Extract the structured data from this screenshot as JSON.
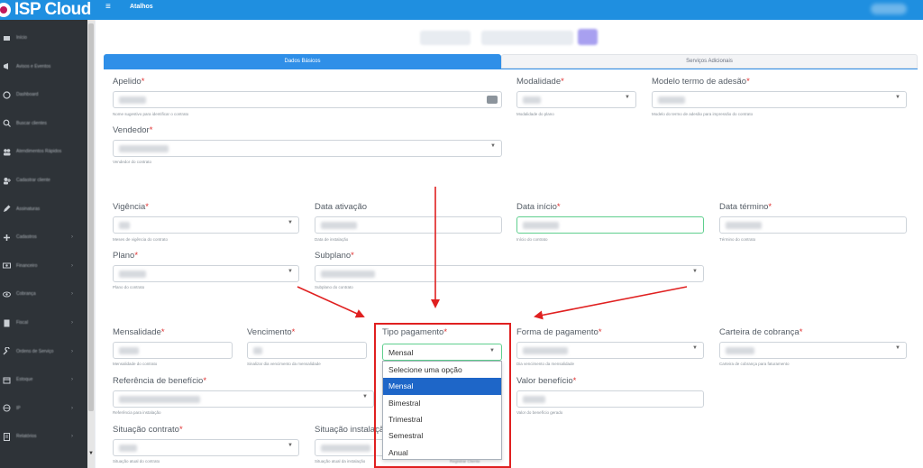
{
  "app": {
    "logo": "ISP Cloud",
    "menu_glyph": "≡",
    "top_link": "Atalhos"
  },
  "sidebar": {
    "items": [
      {
        "label": "Início",
        "icon": "dashboard-icon",
        "chevron": ""
      },
      {
        "label": "Avisos e Eventos",
        "icon": "megaphone-icon",
        "chevron": ""
      },
      {
        "label": "Dashboard",
        "icon": "gauge-icon",
        "chevron": ""
      },
      {
        "label": "Buscar clientes",
        "icon": "search-icon",
        "chevron": ""
      },
      {
        "label": "Atendimentos Rápidos",
        "icon": "users-icon",
        "chevron": ""
      },
      {
        "label": "Cadastrar cliente",
        "icon": "user-plus-icon",
        "chevron": ""
      },
      {
        "label": "Assinaturas",
        "icon": "pencil-icon",
        "chevron": ""
      },
      {
        "label": "Cadastros",
        "icon": "plus-icon",
        "chevron": "›"
      },
      {
        "label": "Financeiro",
        "icon": "money-icon",
        "chevron": "›"
      },
      {
        "label": "Cobrança",
        "icon": "eye-icon",
        "chevron": "›"
      },
      {
        "label": "Fiscal",
        "icon": "file-icon",
        "chevron": "›"
      },
      {
        "label": "Ordens de Serviço",
        "icon": "wrench-icon",
        "chevron": "›"
      },
      {
        "label": "Estoque",
        "icon": "box-icon",
        "chevron": "›"
      },
      {
        "label": "IP",
        "icon": "globe-icon",
        "chevron": "›"
      },
      {
        "label": "Relatórios",
        "icon": "report-icon",
        "chevron": "›"
      }
    ],
    "scroll_down": "▼"
  },
  "tabs": [
    {
      "label": "Dados Básicos"
    },
    {
      "label": "Serviços Adicionais"
    }
  ],
  "form": {
    "apelido": {
      "label": "Apelido",
      "help": "Nome sugestivo para identificar o contrato"
    },
    "modalidade": {
      "label": "Modalidade",
      "help": "Modalidade do plano"
    },
    "modelo_termo": {
      "label": "Modelo termo de adesão",
      "help": "Modelo do termo de adesão para impressão do contrato"
    },
    "vendedor": {
      "label": "Vendedor",
      "help": "Vendedor do contrato"
    },
    "vigencia": {
      "label": "Vigência",
      "help": "Meses de vigência do contrato"
    },
    "data_ativacao": {
      "label": "Data ativação",
      "help": "Data de instalação"
    },
    "data_inicio": {
      "label": "Data início",
      "help": "Início do contrato"
    },
    "data_termino": {
      "label": "Data término",
      "help": "Término do contrato"
    },
    "plano": {
      "label": "Plano",
      "help": "Plano do contrato"
    },
    "subplano": {
      "label": "Subplano",
      "help": "Subplano do contrato"
    },
    "mensalidade": {
      "label": "Mensalidade",
      "help": "Mensalidade do contrato"
    },
    "vencimento": {
      "label": "Vencimento",
      "help": "Sinalizar dia vencimento da mensalidade"
    },
    "tipo_pagamento": {
      "label": "Tipo pagamento",
      "value": "Mensal"
    },
    "forma_pagamento": {
      "label": "Forma de pagamento",
      "help": "Dia vencimento da mensalidade"
    },
    "carteira_cobranca": {
      "label": "Carteira de cobrança",
      "help": "Carteira de cobrança para faturamento"
    },
    "referencia_beneficio": {
      "label": "Referência de benefício",
      "help": "Referência para instalação"
    },
    "valor_beneficio": {
      "label": "Valor benefício",
      "help": "Valor do benefício gerado"
    },
    "situacao_contrato": {
      "label": "Situação contrato",
      "help": "Situação atual do contrato"
    },
    "situacao_instalacao": {
      "label": "Situação instalação",
      "help": "Situação atual da instalação",
      "extra": "Registrar Cliente"
    }
  },
  "dropdown": {
    "options": [
      "Selecione uma opção",
      "Mensal",
      "Bimestral",
      "Trimestral",
      "Semestral",
      "Anual"
    ],
    "selected": "Mensal"
  },
  "colors": {
    "topbar": "#1f8fe0",
    "sidebar": "#2e3338",
    "accent": "#2f8fe8",
    "annotation": "#e02020",
    "selected_option": "#1e66c8"
  }
}
